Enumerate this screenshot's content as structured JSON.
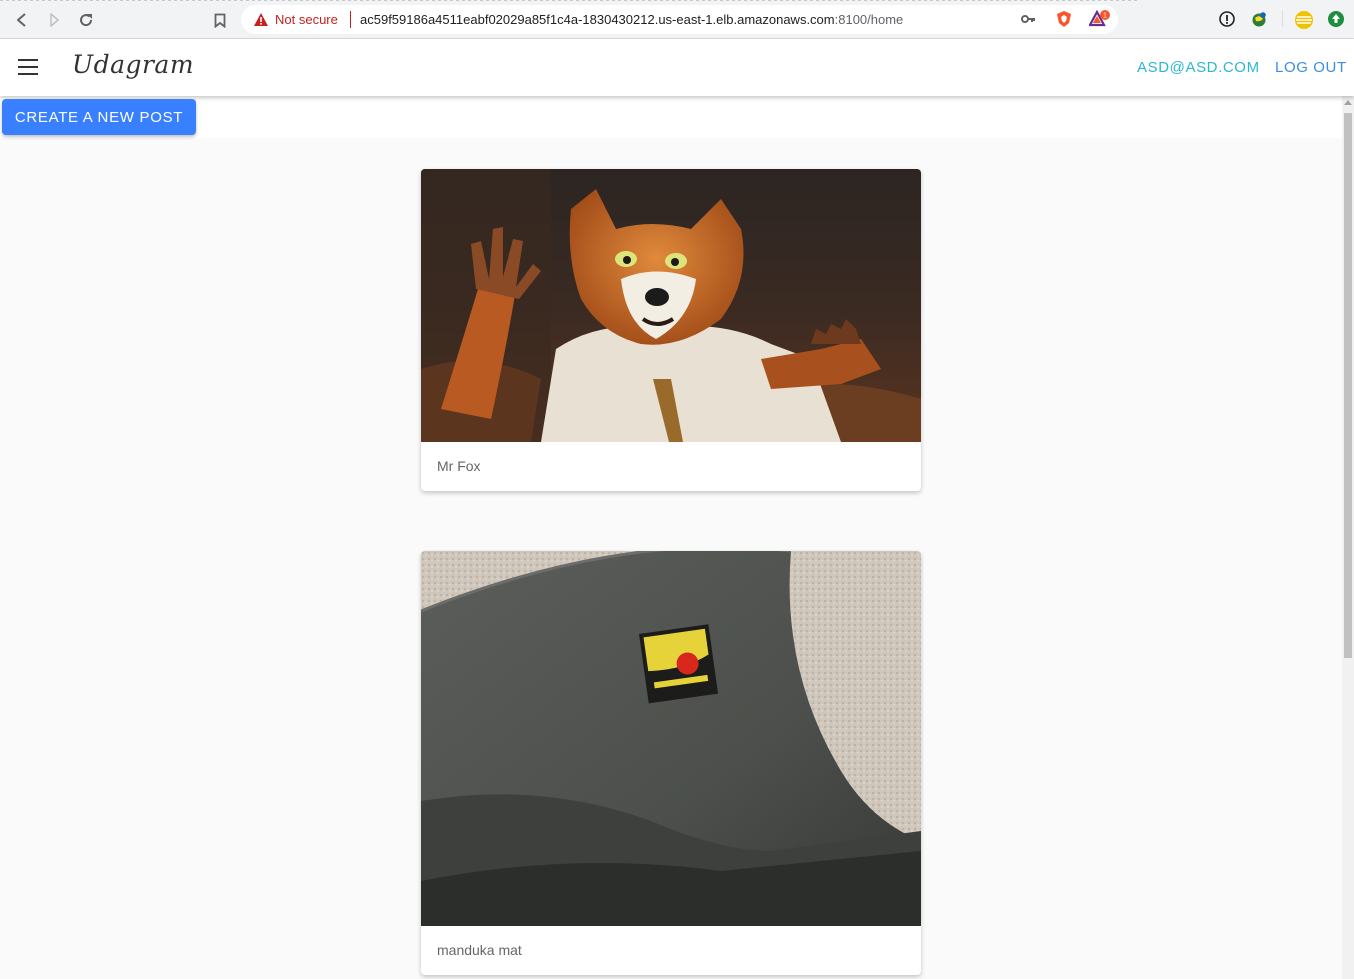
{
  "browser": {
    "security_label": "Not secure",
    "url_main": "ac59f59186a4511eabf02029a85f1c4a-1830430212.us-east-1.elb.amazonaws.com",
    "url_rest": ":8100/home",
    "notification_badge": "1",
    "nav_icons": [
      "back-icon",
      "forward-icon",
      "reload-icon",
      "bookmark-icon"
    ],
    "extension_icons": [
      "password-key-icon",
      "brave-shield-icon",
      "brave-rewards-icon",
      "info-icon",
      "globe-extension-icon",
      "coin-extension-icon",
      "upload-extension-icon"
    ]
  },
  "toolbar": {
    "title": "Udagram",
    "user_email": "ASD@ASD.COM",
    "logout_label": "LOG OUT",
    "menu_icon": "hamburger-menu-icon"
  },
  "actions": {
    "create_post_label": "CREATE A NEW POST"
  },
  "feed": [
    {
      "caption": "Mr Fox",
      "image_description": "photo"
    },
    {
      "caption": "manduka mat",
      "image_description": "photo"
    }
  ],
  "colors": {
    "accent": "#3880ff",
    "email_link": "#2bb6d6",
    "logout_link": "#3b8ee0",
    "warning": "#c5221f"
  }
}
